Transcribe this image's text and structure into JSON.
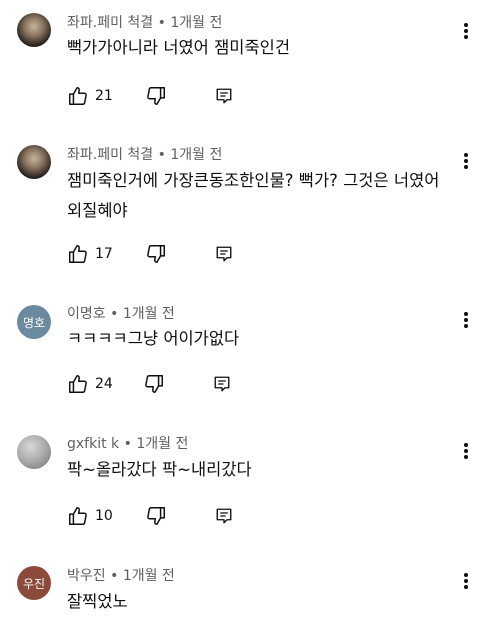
{
  "comments": [
    {
      "author": "좌파.페미 척결",
      "age": "1개월 전",
      "text": "뻑가가아니라 너였어 잼미죽인건",
      "likes": "21",
      "avatar_type": "photo",
      "avatar_text": ""
    },
    {
      "author": "좌파.페미 척결",
      "age": "1개월 전",
      "text": "잼미죽인거에 가장큰동조한인물? 뻑가? 그것은 너였어 외질혜야",
      "likes": "17",
      "avatar_type": "photo",
      "avatar_text": ""
    },
    {
      "author": "이명호",
      "age": "1개월 전",
      "text": "ㅋㅋㅋㅋ그냥 어이가없다",
      "likes": "24",
      "avatar_type": "teal",
      "avatar_text": "명호"
    },
    {
      "author": "gxfkit k",
      "age": "1개월 전",
      "text": "팍~올라갔다 팍~내리갔다",
      "likes": "10",
      "avatar_type": "gray",
      "avatar_text": ""
    },
    {
      "author": "박우진",
      "age": "1개월 전",
      "text": "잘찍었노",
      "likes": "",
      "avatar_type": "brown",
      "avatar_text": "우진"
    }
  ],
  "separator": "•",
  "icons": {
    "like": "thumbs-up-icon",
    "dislike": "thumbs-down-icon",
    "reply": "reply-icon",
    "more": "more-vertical-icon"
  }
}
